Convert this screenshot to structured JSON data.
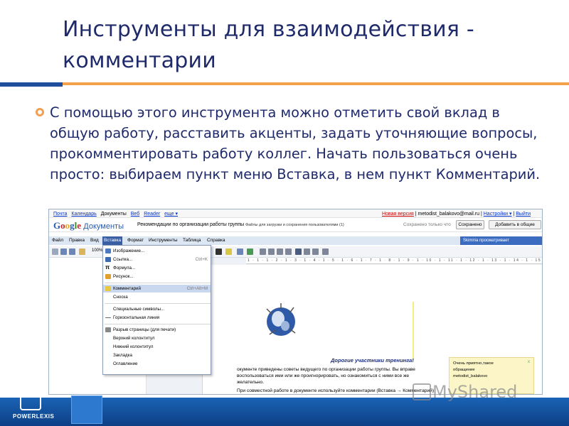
{
  "slide": {
    "title": "Инструменты для взаимодействия - комментарии",
    "body": "С помощью этого инструмента можно отметить свой вклад в общую работу, расставить акценты, задать уточняющие вопросы, прокомментировать работу коллег. Начать пользоваться очень просто: выбираем пункт меню Вставка, в нем пункт Комментарий.",
    "brand": "POWERLEXIS",
    "watermark": "MyShared"
  },
  "topbar": {
    "links": [
      "Почта",
      "Календарь",
      "Документы",
      "Веб",
      "Reader",
      "еще ▾"
    ],
    "new_version": "Новая версия",
    "user": "metodist_balakovo@mail.ru",
    "settings": "Настройки ▾",
    "logout": "Выйти"
  },
  "docs": {
    "logo_main": "Google",
    "logo_docs": "Документы",
    "doc_title": "Рекомендации по организации работы группы",
    "share_note": "Файлы для загрузки и сохранения пользователями (1)",
    "saved_status": "Сохранено только что",
    "saved_button": "Сохранено",
    "share_button": "Добавить в общие"
  },
  "menu": {
    "items": [
      "Файл",
      "Правка",
      "Вид",
      "Вставка",
      "Формат",
      "Инструменты",
      "Таблица",
      "Справка"
    ],
    "active": "Вставка",
    "view_notice": "Skimiria просматривает"
  },
  "toolbar": {
    "zoom": "100%"
  },
  "ruler": "1 · 1 · 1 · 2 · 1 · 3 · 1 · 4 · 1 · 5 · 1 · 6 · 1 · 7 · 1 · 8 · 1 · 9 · 1 · 10 · 1 · 11 · 1 · 12 · 1 · 13 · 1 · 14 · 1 · 15 · 1 · 16 · 1 · 17 · 1 · 18 · 1 · 19 ·",
  "dropdown": {
    "items": [
      {
        "label": "Изображение...",
        "shortcut": "",
        "icon_color": "#4a7ac0"
      },
      {
        "label": "Ссылка...",
        "shortcut": "Ctrl+K",
        "icon_color": "#3a6ab0"
      },
      {
        "label": "Формула...",
        "shortcut": "",
        "icon_color": "#222222"
      },
      {
        "label": "Рисунок...",
        "shortcut": "",
        "icon_color": "#e0a030"
      },
      {
        "label": "Комментарий",
        "shortcut": "Ctrl+Alt+M",
        "icon_color": "#e8c840"
      },
      {
        "label": "Сноска",
        "shortcut": "",
        "icon_color": ""
      },
      {
        "label": "Специальные символы...",
        "shortcut": "",
        "icon_color": ""
      },
      {
        "label": "Горизонтальная линия",
        "shortcut": "",
        "icon_color": "#666666"
      },
      {
        "label": "Разрыв страницы (для печати)",
        "shortcut": "",
        "icon_color": "#888888"
      },
      {
        "label": "Верхний колонтитул",
        "shortcut": "",
        "icon_color": ""
      },
      {
        "label": "Нижний колонтитул",
        "shortcut": "",
        "icon_color": ""
      },
      {
        "label": "Закладка",
        "shortcut": "",
        "icon_color": ""
      },
      {
        "label": "Оглавление",
        "shortcut": "",
        "icon_color": ""
      }
    ],
    "highlighted": "Комментарий"
  },
  "document": {
    "greeting": "Дорогие участники тренинга!",
    "lines": [
      "окументе приведены советы ведущего по организации работы группы. Вы вправе",
      "воспользоваться ими или же проигнорировать, но ознакомиться с ними все же",
      "желательно.",
      "При совместной работе в документе используйте комментарии (Вставка → Комментарий)"
    ]
  },
  "comment": {
    "line1": "Очень приятно,такое",
    "line2": "обращение",
    "author": "metodist_balakovo",
    "close": "x"
  },
  "colors": {
    "title": "#1f2a6b",
    "accent_orange": "#f4a24a",
    "accent_blue": "#1f4e9c",
    "menu_active": "#3b5fa3"
  }
}
